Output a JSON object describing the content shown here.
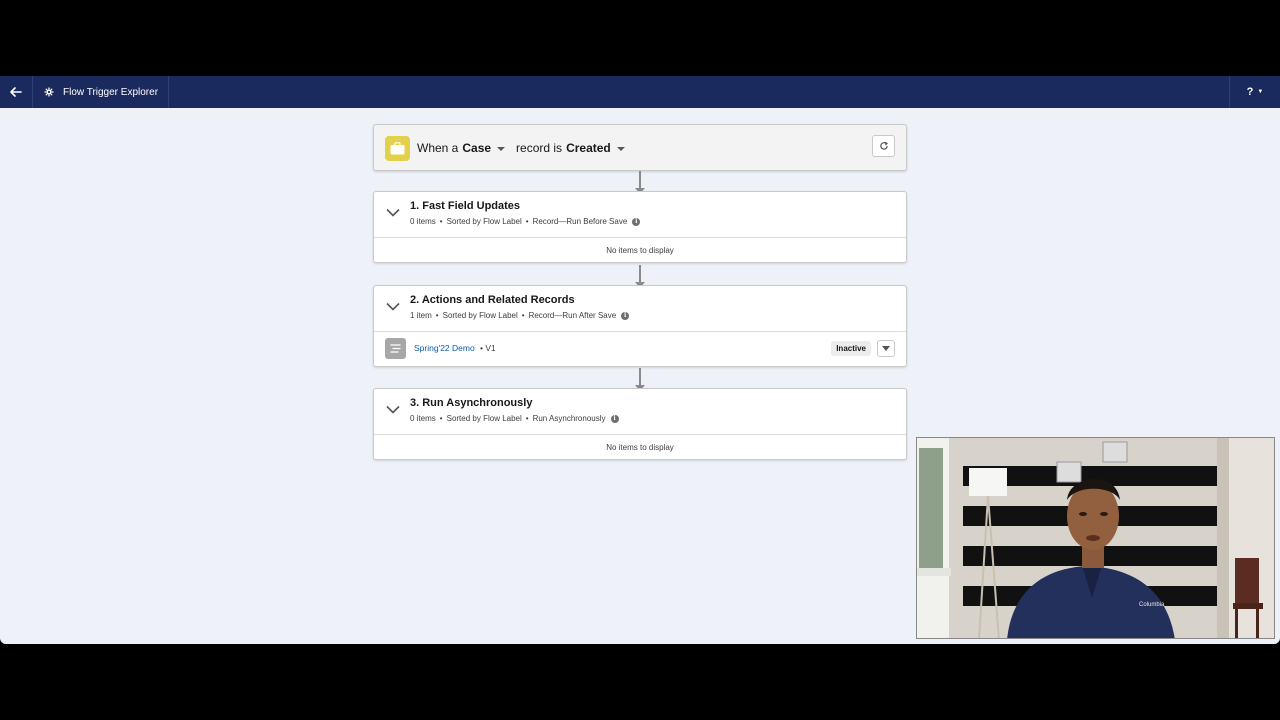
{
  "header": {
    "app_title": "Flow Trigger Explorer",
    "help_label": "?"
  },
  "trigger": {
    "prefix": "When a",
    "object": "Case",
    "middle": "record is",
    "event": "Created"
  },
  "sections": [
    {
      "title": "1. Fast Field Updates",
      "count": "0 items",
      "sort": "Sorted by Flow Label",
      "context": "Record—Run Before Save",
      "empty_text": "No items to display"
    },
    {
      "title": "2. Actions and Related Records",
      "count": "1 item",
      "sort": "Sorted by Flow Label",
      "context": "Record—Run After Save",
      "flows": [
        {
          "name": "Spring'22 Demo",
          "version": "• V1",
          "status": "Inactive"
        }
      ]
    },
    {
      "title": "3. Run Asynchronously",
      "count": "0 items",
      "sort": "Sorted by Flow Label",
      "context": "Run Asynchronously",
      "empty_text": "No items to display"
    }
  ],
  "bullet": "•",
  "info_glyph": "i",
  "colors": {
    "header_bg": "#1b2a5e",
    "canvas_bg": "#eef1f7",
    "trigger_icon": "#e3d14b",
    "link": "#0b5cab"
  },
  "icons": {
    "back": "arrow-left-icon",
    "app": "flow-gear-icon",
    "object": "briefcase-icon",
    "refresh": "refresh-icon",
    "expand": "chevron-down-icon",
    "flow": "flow-icon",
    "info": "info-icon"
  }
}
